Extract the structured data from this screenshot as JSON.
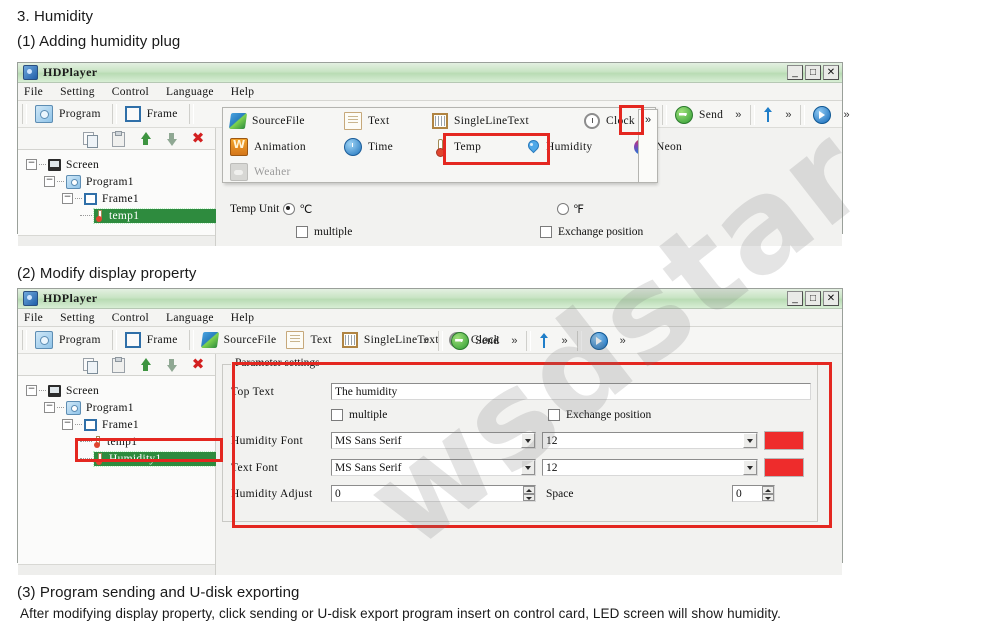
{
  "document": {
    "section_title": "3. Humidity",
    "step1": "(1) Adding humidity plug",
    "step2": "(2) Modify display property",
    "step3": "(3) Program sending and U-disk exporting",
    "step3_body": "After modifying display property, click sending or U-disk export program insert on control card, LED screen will show humidity.",
    "watermark": "wsdstar"
  },
  "window1": {
    "title": "HDPlayer",
    "controls": {
      "minimize": "_",
      "maximize": "□",
      "close": "✕"
    },
    "menu": [
      "File",
      "Setting",
      "Control",
      "Language",
      "Help"
    ],
    "toolbar_main": [
      {
        "label": "Program",
        "icon": "program-icon"
      },
      {
        "label": "Frame",
        "icon": "frame-icon"
      }
    ],
    "toolbar_plugins_row1": [
      {
        "label": "SourceFile",
        "icon": "sourcefile-icon"
      },
      {
        "label": "Text",
        "icon": "text-icon"
      },
      {
        "label": "SingleLineText",
        "icon": "singlelinetext-icon"
      },
      {
        "label": "Clock",
        "icon": "clock-icon"
      }
    ],
    "toolbar_plugins_row2": [
      {
        "label": "Animation",
        "icon": "animation-icon"
      },
      {
        "label": "Time",
        "icon": "time-icon"
      },
      {
        "label": "Temp",
        "icon": "temp-icon"
      },
      {
        "label": "Humidity",
        "icon": "humidity-icon"
      },
      {
        "label": "Neon",
        "icon": "neon-icon"
      }
    ],
    "toolbar_plugins_row3": [
      {
        "label": "Weaher",
        "icon": "weather-icon"
      }
    ],
    "toolbar_right": [
      {
        "label": "Send",
        "icon": "send-icon"
      },
      {
        "label": "",
        "icon": "updown-arrow-icon"
      },
      {
        "label": "",
        "icon": "play-icon"
      }
    ],
    "overflow_chevron": "»",
    "tree_tools": [
      "copy-icon",
      "paste-icon",
      "move-up-icon",
      "move-down-icon",
      "delete-icon"
    ],
    "tree": [
      {
        "label": "Screen",
        "icon": "screen-icon",
        "depth": 0,
        "selected": false
      },
      {
        "label": "Program1",
        "icon": "program-icon",
        "depth": 1,
        "selected": false
      },
      {
        "label": "Frame1",
        "icon": "frame-icon",
        "depth": 2,
        "selected": false
      },
      {
        "label": "temp1",
        "icon": "temp-icon",
        "depth": 3,
        "selected": true
      }
    ],
    "props": {
      "temp_unit_label": "Temp Unit",
      "unit_celsius": "℃",
      "unit_fahrenheit": "℉",
      "celsius_selected": true,
      "multiple_label": "multiple",
      "multiple_checked": false,
      "exchange_label": "Exchange position",
      "exchange_checked": false
    }
  },
  "window2": {
    "title": "HDPlayer",
    "controls": {
      "minimize": "_",
      "maximize": "□",
      "close": "✕"
    },
    "menu": [
      "File",
      "Setting",
      "Control",
      "Language",
      "Help"
    ],
    "toolbar_main": [
      {
        "label": "Program",
        "icon": "program-icon"
      },
      {
        "label": "Frame",
        "icon": "frame-icon"
      }
    ],
    "toolbar_plugins": [
      {
        "label": "SourceFile",
        "icon": "sourcefile-icon"
      },
      {
        "label": "Text",
        "icon": "text-icon"
      },
      {
        "label": "SingleLineText",
        "icon": "singlelinetext-icon"
      },
      {
        "label": "Clock",
        "icon": "clock-icon"
      }
    ],
    "toolbar_right": [
      {
        "label": "Send",
        "icon": "send-icon"
      },
      {
        "label": "",
        "icon": "updown-arrow-icon"
      },
      {
        "label": "",
        "icon": "play-icon"
      }
    ],
    "overflow_chevron": "»",
    "tree_tools": [
      "copy-icon",
      "paste-icon",
      "move-up-icon",
      "move-down-icon",
      "delete-icon"
    ],
    "tree": [
      {
        "label": "Screen",
        "icon": "screen-icon",
        "depth": 0,
        "selected": false
      },
      {
        "label": "Program1",
        "icon": "program-icon",
        "depth": 1,
        "selected": false
      },
      {
        "label": "Frame1",
        "icon": "frame-icon",
        "depth": 2,
        "selected": false
      },
      {
        "label": "temp1",
        "icon": "temp-icon",
        "depth": 3,
        "selected": false
      },
      {
        "label": "Humidity1",
        "icon": "humidity-icon",
        "depth": 3,
        "selected": true
      }
    ],
    "panel": {
      "group_title": "Parameter settings",
      "top_text_label": "Top Text",
      "top_text_value": "The humidity",
      "multiple_label": "multiple",
      "multiple_checked": false,
      "exchange_label": "Exchange position",
      "exchange_checked": false,
      "humidity_font_label": "Humidity Font",
      "humidity_font_value": "MS Sans Serif",
      "humidity_font_size": "12",
      "humidity_font_color": "#ee2c2c",
      "text_font_label": "Text Font",
      "text_font_value": "MS Sans Serif",
      "text_font_size": "12",
      "text_font_color": "#ee2c2c",
      "humidity_adjust_label": "Humidity Adjust",
      "humidity_adjust_value": "0",
      "space_label": "Space",
      "space_value": "0"
    }
  }
}
